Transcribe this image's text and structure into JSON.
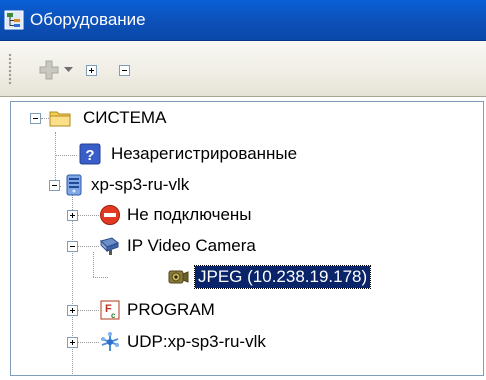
{
  "window": {
    "title": "Оборудование",
    "icon": "hardware-tree-icon"
  },
  "toolbar": {
    "add_icon": "add-plus-icon",
    "dropdown_icon": "chevron-down-icon",
    "expand_all_icon": "expand-all-icon",
    "collapse_all_icon": "collapse-all-icon"
  },
  "tree": {
    "root": {
      "label": "СИСТЕМА",
      "icon": "folder-icon"
    },
    "unregistered": {
      "label": "Незарегистрированные",
      "icon": "question-icon"
    },
    "server": {
      "label": "xp-sp3-ru-vlk",
      "icon": "server-icon"
    },
    "not_connected": {
      "label": "Не подключены",
      "icon": "no-entry-icon"
    },
    "ip_camera": {
      "label": "IP Video Camera",
      "icon": "camera-icon"
    },
    "jpeg": {
      "label": "JPEG (10.238.19.178)",
      "icon": "camera-device-icon"
    },
    "program": {
      "label": "PROGRAM",
      "icon": "program-icon"
    },
    "udp": {
      "label": "UDP:xp-sp3-ru-vlk",
      "icon": "network-icon"
    }
  },
  "colors": {
    "title_bar": "#0c50b8",
    "selection": "#0a246a",
    "toolbar": "#efede4"
  }
}
